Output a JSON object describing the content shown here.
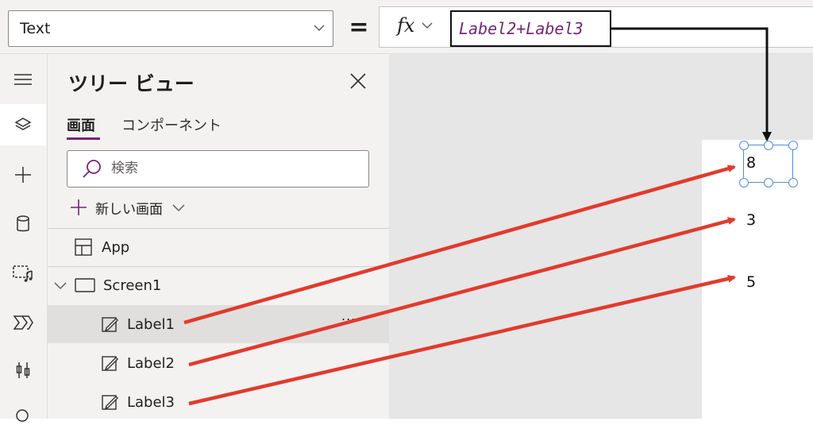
{
  "formula_bar": {
    "property": "Text",
    "equals": "=",
    "fx": "fx",
    "formula": "Label2+Label3"
  },
  "left_rail": {
    "icons": [
      "hamburger-icon",
      "layers-icon",
      "plus-icon",
      "database-icon",
      "media-icon",
      "power-automate-icon",
      "tools-icon",
      "search-icon"
    ]
  },
  "tree_view": {
    "title": "ツリー ビュー",
    "tabs": [
      "画面",
      "コンポーネント"
    ],
    "search_placeholder": "検索",
    "new_screen": "新しい画面",
    "items": [
      {
        "label": "App",
        "icon": "app-icon"
      },
      {
        "label": "Screen1",
        "icon": "screen-icon",
        "expanded": true
      },
      {
        "label": "Label1",
        "icon": "label-edit-icon",
        "selected": true,
        "more": "..."
      },
      {
        "label": "Label2",
        "icon": "label-edit-icon"
      },
      {
        "label": "Label3",
        "icon": "label-edit-icon"
      }
    ]
  },
  "canvas": {
    "labels": [
      {
        "name": "Label1",
        "value": "8"
      },
      {
        "name": "Label2",
        "value": "3"
      },
      {
        "name": "Label3",
        "value": "5"
      }
    ]
  },
  "colors": {
    "accent": "#742774",
    "selection": "#4f8fd6",
    "annotation_arrow": "#e23a2c"
  }
}
